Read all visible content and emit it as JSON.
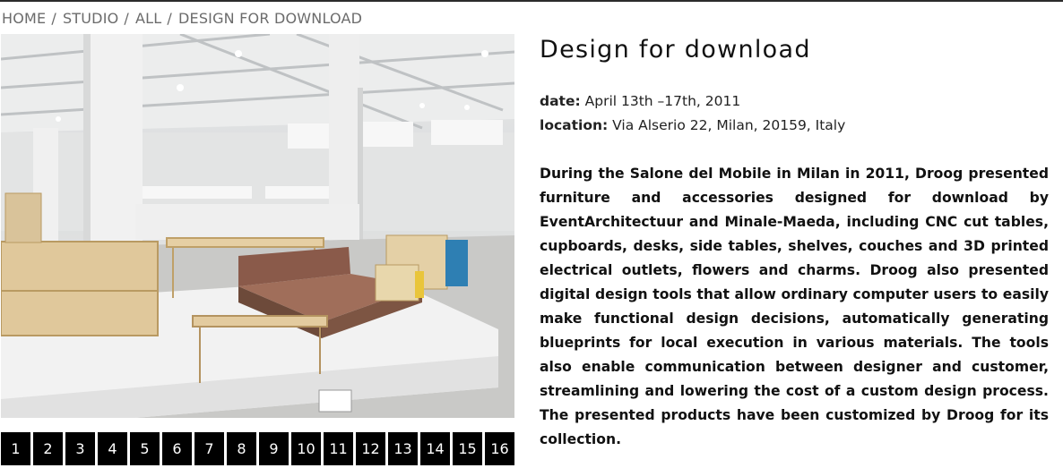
{
  "breadcrumb": {
    "items": [
      "HOME",
      "STUDIO",
      "ALL"
    ],
    "current": "DESIGN FOR DOWNLOAD",
    "separator": "/"
  },
  "gallery": {
    "pages": [
      "1",
      "2",
      "3",
      "4",
      "5",
      "6",
      "7",
      "8",
      "9",
      "10",
      "11",
      "12",
      "13",
      "14",
      "15",
      "16"
    ]
  },
  "article": {
    "title": "Design for download",
    "date_label": "date:",
    "date_value": "April 13th –17th, 2011",
    "location_label": "location:",
    "location_value": "Via Alserio 22, Milan, 20159, Italy",
    "description": "During the Salone del Mobile in Milan in 2011, Droog presented furniture and accessories designed for download by EventArchitectuur and Minale-Maeda, including CNC cut tables, cupboards, desks, side tables, shelves, couches and 3D printed electrical outlets, flowers and charms. Droog also presented digital design tools that allow ordinary computer users to easily make functional design decisions, automatically generating blueprints for local execution in various materials. The tools also enable communication between designer and customer, streamlining and lowering the cost of a custom design process. The presented products have been customized by Droog for its collection."
  }
}
